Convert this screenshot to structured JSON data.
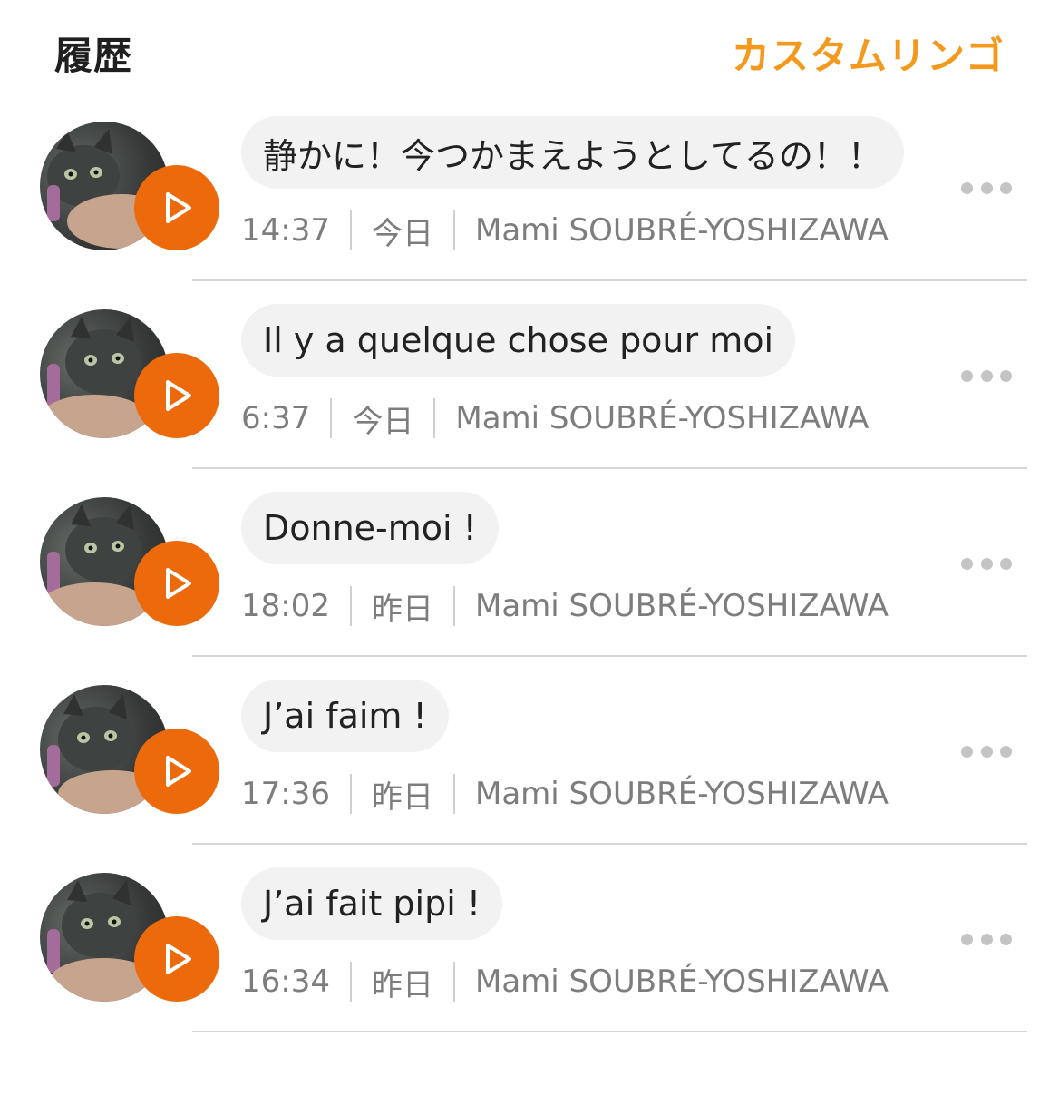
{
  "header": {
    "title": "履歴",
    "action_label": "カスタムリンゴ"
  },
  "colors": {
    "accent": "#f39a1e",
    "play_button": "#ec6a0c",
    "bubble_bg": "#f2f2f2",
    "meta_text": "#7d7d7d"
  },
  "history": [
    {
      "message": "静かに！今つかまえようとしてるの！！",
      "time": "14:37",
      "day": "今日",
      "sender": "Mami SOUBRÉ-YOSHIZAWA"
    },
    {
      "message": "Il y a quelque chose pour moi",
      "time": "6:37",
      "day": "今日",
      "sender": "Mami SOUBRÉ-YOSHIZAWA"
    },
    {
      "message": "Donne-moi !",
      "time": "18:02",
      "day": "昨日",
      "sender": "Mami SOUBRÉ-YOSHIZAWA"
    },
    {
      "message": "J’ai faim !",
      "time": "17:36",
      "day": "昨日",
      "sender": "Mami SOUBRÉ-YOSHIZAWA"
    },
    {
      "message": "J’ai fait pipi !",
      "time": "16:34",
      "day": "昨日",
      "sender": "Mami SOUBRÉ-YOSHIZAWA"
    }
  ]
}
